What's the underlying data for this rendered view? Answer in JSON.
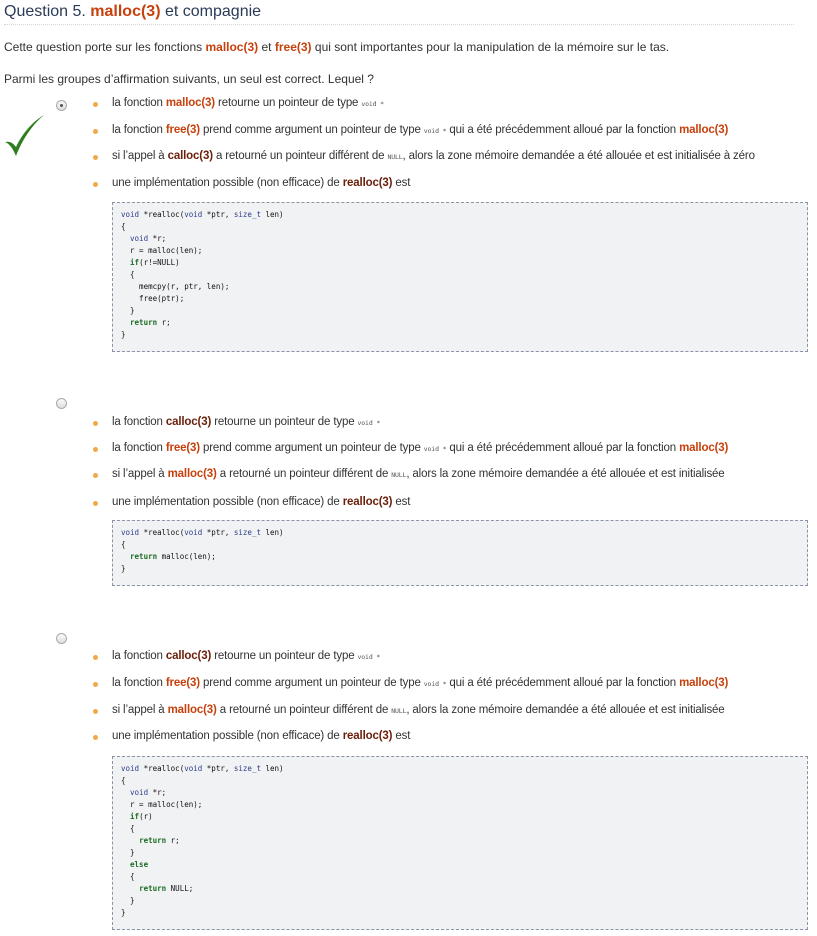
{
  "question": {
    "prefix": "Question 5.",
    "title_hl": "malloc(3)",
    "title_rest": "et compagnie",
    "intro": {
      "p1": "Cette question porte sur les fonctions",
      "f1": "malloc(3)",
      "p2": "et",
      "f2": "free(3)",
      "p3": "qui sont importantes pour la manipulation de la mémoire sur le tas."
    },
    "prompt": "Parmi les groupes d’affirmation suivants, un seul est correct. Lequel ?"
  },
  "options": [
    {
      "selected": true,
      "correct": true,
      "items": [
        [
          "la fonction",
          "malloc(3)",
          "retourne un pointeur de type",
          "void *"
        ],
        [
          "la fonction",
          "free(3)",
          "prend comme argument un pointeur de type",
          "void *",
          "qui a été précédemment alloué par la fonction",
          "malloc(3)"
        ],
        [
          "si l’appel à",
          "calloc(3)",
          "a retourné un pointeur différent de",
          "NULL",
          ", alors la zone mémoire demandée a été allouée et est initialisée à zéro"
        ],
        [
          "une implémentation possible (non efficace) de",
          "realloc(3)",
          "est"
        ]
      ],
      "code": [
        "void *realloc(void *ptr, size_t len)",
        "{",
        "  void *r;",
        "  r = malloc(len);",
        "  if(r!=NULL)",
        "  {",
        "    memcpy(r, ptr, len);",
        "    free(ptr);",
        "  }",
        "  return r;",
        "}"
      ]
    },
    {
      "selected": false,
      "correct": false,
      "items": [
        [
          "la fonction",
          "calloc(3)",
          "retourne un pointeur de type",
          "void *"
        ],
        [
          "la fonction",
          "free(3)",
          "prend comme argument un pointeur de type",
          "void *",
          "qui a été précédemment alloué par la fonction",
          "malloc(3)"
        ],
        [
          "si l’appel à",
          "malloc(3)",
          "a retourné un pointeur différent de",
          "NULL",
          ", alors la zone mémoire demandée a été allouée et est initialisée"
        ],
        [
          "une implémentation possible (non efficace) de",
          "realloc(3)",
          "est"
        ]
      ],
      "code": [
        "void *realloc(void *ptr, size_t len)",
        "{",
        "  return malloc(len);",
        "}"
      ]
    },
    {
      "selected": false,
      "correct": false,
      "items": [
        [
          "la fonction",
          "calloc(3)",
          "retourne un pointeur de type",
          "void *"
        ],
        [
          "la fonction",
          "free(3)",
          "prend comme argument un pointeur de type",
          "void *",
          "qui a été précédemment alloué par la fonction",
          "malloc(3)"
        ],
        [
          "si l’appel à",
          "malloc(3)",
          "a retourné un pointeur différent de",
          "NULL",
          ", alors la zone mémoire demandée a été allouée et est initialisée"
        ],
        [
          "une implémentation possible (non efficace) de",
          "realloc(3)",
          "est"
        ]
      ],
      "code": [
        "void *realloc(void *ptr, size_t len)",
        "{",
        "  void *r;",
        "  r = malloc(len);",
        "  if(r)",
        "  {",
        "    return r;",
        "  }",
        "  else",
        "  {",
        "    return NULL;",
        "  }",
        "}"
      ]
    }
  ],
  "colors": {
    "accent": "#c7410d",
    "title": "#2a3b57",
    "bullet": "#f0a84a",
    "check": "#2f7d1e"
  },
  "icons": {
    "correct": "checkmark-icon"
  }
}
